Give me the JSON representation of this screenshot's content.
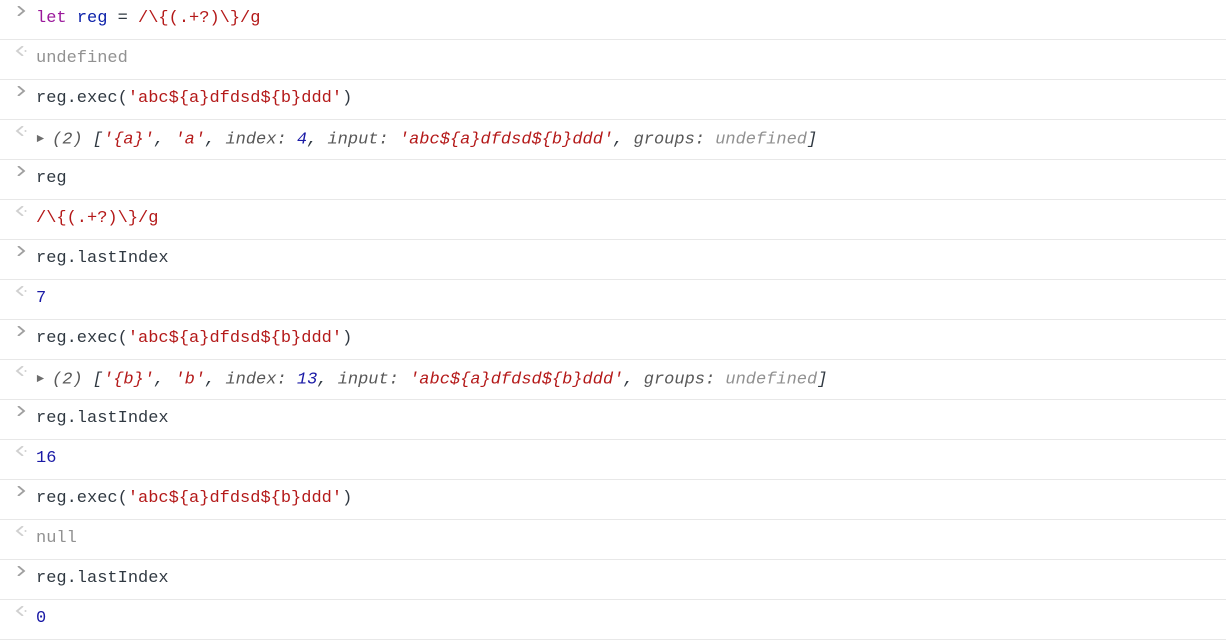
{
  "line1": {
    "kw": "let",
    "var": "reg",
    "eq": " = ",
    "regex": "/\\{(.+?)\\}/g"
  },
  "line2": {
    "undef": "undefined"
  },
  "line3": {
    "head": "reg.exec(",
    "str": "'abc${a}dfdsd${b}ddd'",
    "tail": ")"
  },
  "line4": {
    "count": "(2)",
    "open": " [",
    "s1": "'{a}'",
    "c1": ", ",
    "s2": "'a'",
    "c2": ", ",
    "k_index": "index: ",
    "v_index": "4",
    "c3": ", ",
    "k_input": "input: ",
    "v_input": "'abc${a}dfdsd${b}ddd'",
    "c4": ", ",
    "k_groups": "groups: ",
    "v_groups": "undefined",
    "close": "]"
  },
  "line5": {
    "text": "reg"
  },
  "line6": {
    "regex": "/\\{(.+?)\\}/g"
  },
  "line7": {
    "text": "reg.lastIndex"
  },
  "line8": {
    "num": "7"
  },
  "line9": {
    "head": "reg.exec(",
    "str": "'abc${a}dfdsd${b}ddd'",
    "tail": ")"
  },
  "line10": {
    "count": "(2)",
    "open": " [",
    "s1": "'{b}'",
    "c1": ", ",
    "s2": "'b'",
    "c2": ", ",
    "k_index": "index: ",
    "v_index": "13",
    "c3": ", ",
    "k_input": "input: ",
    "v_input": "'abc${a}dfdsd${b}ddd'",
    "c4": ", ",
    "k_groups": "groups: ",
    "v_groups": "undefined",
    "close": "]"
  },
  "line11": {
    "text": "reg.lastIndex"
  },
  "line12": {
    "num": "16"
  },
  "line13": {
    "head": "reg.exec(",
    "str": "'abc${a}dfdsd${b}ddd'",
    "tail": ")"
  },
  "line14": {
    "null": "null"
  },
  "line15": {
    "text": "reg.lastIndex"
  },
  "line16": {
    "num": "0"
  }
}
